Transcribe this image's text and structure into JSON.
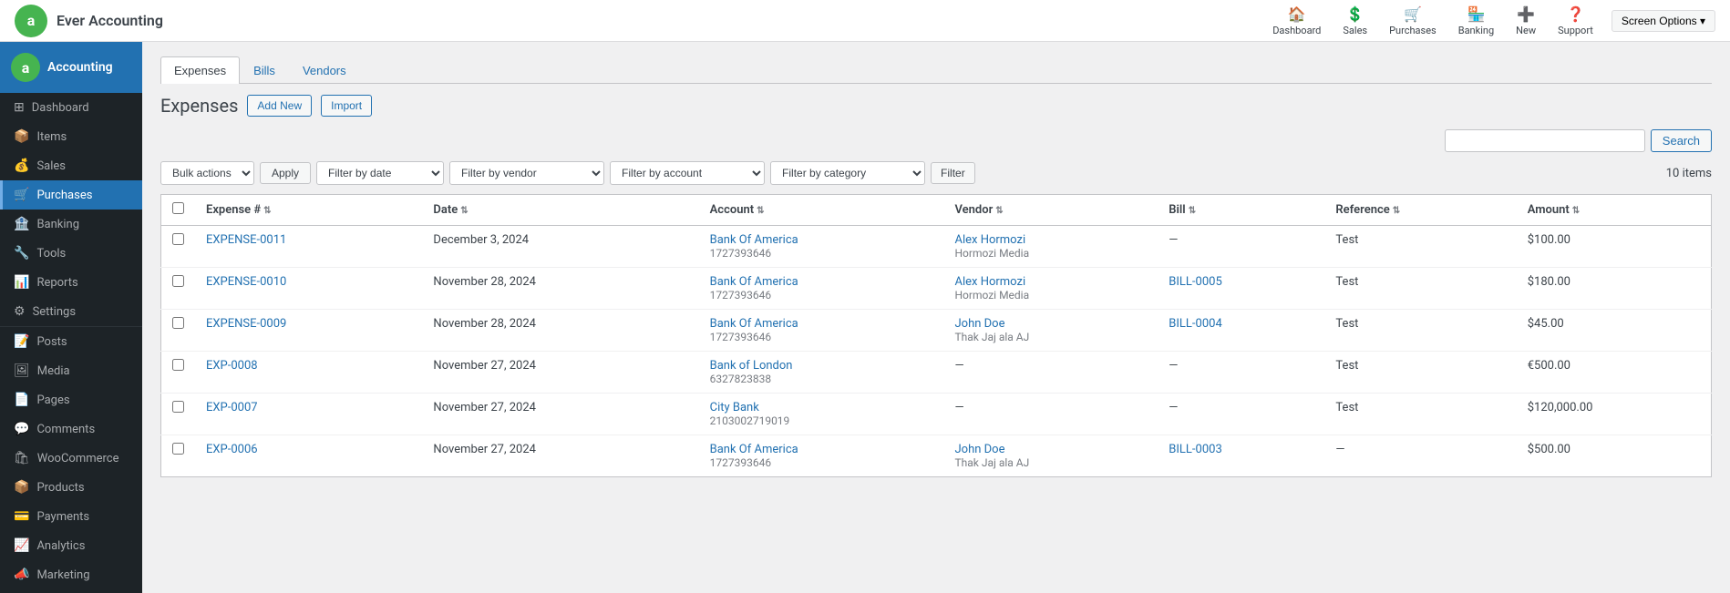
{
  "topBar": {
    "title": "Ever Accounting",
    "navItems": [
      {
        "label": "Dashboard",
        "icon": "🏠",
        "name": "dashboard"
      },
      {
        "label": "Sales",
        "icon": "💲",
        "name": "sales"
      },
      {
        "label": "Purchases",
        "icon": "🛒",
        "name": "purchases"
      },
      {
        "label": "Banking",
        "icon": "🏪",
        "name": "banking"
      },
      {
        "label": "New",
        "icon": "➕",
        "name": "new"
      },
      {
        "label": "Support",
        "icon": "❓",
        "name": "support"
      }
    ],
    "screenOptions": "Screen Options"
  },
  "sidebar": {
    "accountingItems": [
      {
        "label": "Dashboard",
        "icon": "⊞",
        "name": "dashboard",
        "active": false
      },
      {
        "label": "Items",
        "icon": "📦",
        "name": "items",
        "active": false
      },
      {
        "label": "Sales",
        "icon": "💰",
        "name": "sales",
        "active": false
      },
      {
        "label": "Purchases",
        "icon": "🛒",
        "name": "purchases",
        "active": true
      },
      {
        "label": "Banking",
        "icon": "🏦",
        "name": "banking",
        "active": false
      },
      {
        "label": "Tools",
        "icon": "🔧",
        "name": "tools",
        "active": false
      },
      {
        "label": "Reports",
        "icon": "📊",
        "name": "reports",
        "active": false
      },
      {
        "label": "Settings",
        "icon": "⚙",
        "name": "settings",
        "active": false
      }
    ],
    "wpItems": [
      {
        "label": "Posts",
        "icon": "📝",
        "name": "posts",
        "active": false
      },
      {
        "label": "Media",
        "icon": "🖼",
        "name": "media",
        "active": false
      },
      {
        "label": "Pages",
        "icon": "📄",
        "name": "pages",
        "active": false
      },
      {
        "label": "Comments",
        "icon": "💬",
        "name": "comments",
        "active": false
      },
      {
        "label": "WooCommerce",
        "icon": "🛍",
        "name": "woocommerce",
        "active": false
      },
      {
        "label": "Products",
        "icon": "📦",
        "name": "products",
        "active": false
      },
      {
        "label": "Payments",
        "icon": "💳",
        "name": "payments",
        "active": false
      },
      {
        "label": "Analytics",
        "icon": "📈",
        "name": "analytics",
        "active": false
      },
      {
        "label": "Marketing",
        "icon": "📣",
        "name": "marketing",
        "active": false
      }
    ]
  },
  "tabs": [
    {
      "label": "Expenses",
      "active": true
    },
    {
      "label": "Bills",
      "active": false
    },
    {
      "label": "Vendors",
      "active": false
    }
  ],
  "page": {
    "title": "Expenses",
    "addNewLabel": "Add New",
    "importLabel": "Import"
  },
  "search": {
    "placeholder": "",
    "buttonLabel": "Search"
  },
  "filters": {
    "bulkActions": "Bulk actions",
    "applyLabel": "Apply",
    "filterByDate": "Filter by date",
    "filterByVendor": "Filter by vendor",
    "filterByAccount": "Filter by account",
    "filterByCategory": "Filter by category",
    "filterLabel": "Filter",
    "itemsCount": "10 items"
  },
  "table": {
    "columns": [
      {
        "label": "Expense #",
        "key": "expense_num"
      },
      {
        "label": "Date",
        "key": "date"
      },
      {
        "label": "Account",
        "key": "account"
      },
      {
        "label": "Vendor",
        "key": "vendor"
      },
      {
        "label": "Bill",
        "key": "bill"
      },
      {
        "label": "Reference",
        "key": "reference"
      },
      {
        "label": "Amount",
        "key": "amount"
      }
    ],
    "rows": [
      {
        "expense_num": "EXPENSE-0011",
        "date": "December 3, 2024",
        "account": "Bank Of America",
        "account_num": "1727393646",
        "vendor": "Alex Hormozi",
        "vendor_sub": "Hormozi Media",
        "bill": "—",
        "bill_link": false,
        "reference": "Test",
        "amount": "$100.00"
      },
      {
        "expense_num": "EXPENSE-0010",
        "date": "November 28, 2024",
        "account": "Bank Of America",
        "account_num": "1727393646",
        "vendor": "Alex Hormozi",
        "vendor_sub": "Hormozi Media",
        "bill": "BILL-0005",
        "bill_link": true,
        "reference": "Test",
        "amount": "$180.00"
      },
      {
        "expense_num": "EXPENSE-0009",
        "date": "November 28, 2024",
        "account": "Bank Of America",
        "account_num": "1727393646",
        "vendor": "John Doe",
        "vendor_sub": "Thak Jaj ala AJ",
        "bill": "BILL-0004",
        "bill_link": true,
        "reference": "Test",
        "amount": "$45.00"
      },
      {
        "expense_num": "EXP-0008",
        "date": "November 27, 2024",
        "account": "Bank of London",
        "account_num": "6327823838",
        "vendor": "—",
        "vendor_sub": "",
        "bill": "—",
        "bill_link": false,
        "reference": "Test",
        "amount": "€500.00"
      },
      {
        "expense_num": "EXP-0007",
        "date": "November 27, 2024",
        "account": "City Bank",
        "account_num": "2103002719019",
        "vendor": "—",
        "vendor_sub": "",
        "bill": "—",
        "bill_link": false,
        "reference": "Test",
        "amount": "$120,000.00"
      },
      {
        "expense_num": "EXP-0006",
        "date": "November 27, 2024",
        "account": "Bank Of America",
        "account_num": "1727393646",
        "vendor": "John Doe",
        "vendor_sub": "Thak Jaj ala AJ",
        "bill": "BILL-0003",
        "bill_link": true,
        "reference": "—",
        "amount": "$500.00"
      }
    ]
  }
}
